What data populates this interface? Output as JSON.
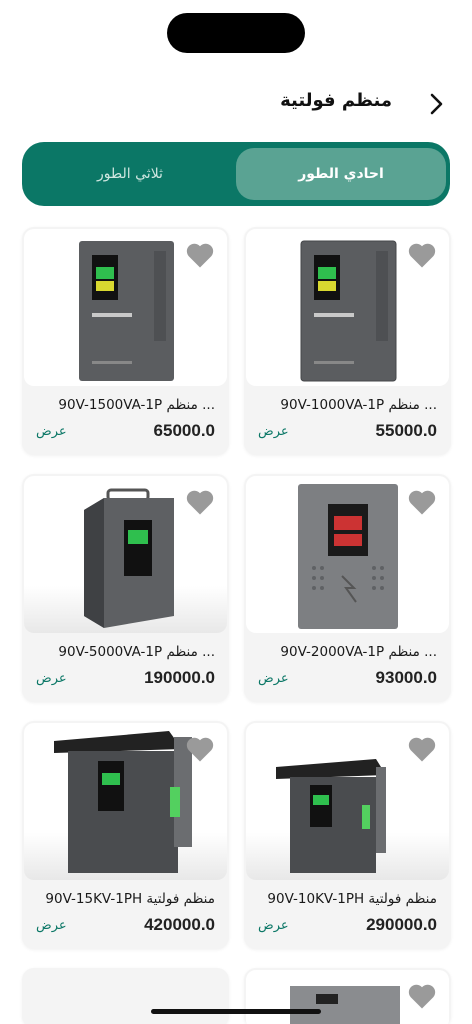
{
  "header": {
    "title": "منظم فولتية"
  },
  "tabs": [
    {
      "label": "احادي الطور",
      "active": true
    },
    {
      "label": "ثلاثي الطور",
      "active": false
    }
  ],
  "colors": {
    "accent": "#0b7766",
    "active_tab": "#5aa393",
    "heart": "#9a9a9a"
  },
  "products": [
    {
      "name": "90V-1000VA-1P منظم ...",
      "price": "55000.0",
      "action": "عرض"
    },
    {
      "name": "90V-1500VA-1P منظم ...",
      "price": "65000.0",
      "action": "عرض"
    },
    {
      "name": "90V-2000VA-1P منظم ...",
      "price": "93000.0",
      "action": "عرض"
    },
    {
      "name": "90V-5000VA-1P منظم ...",
      "price": "190000.0",
      "action": "عرض"
    },
    {
      "name": "90V-10KV-1PH منظم فولتية",
      "price": "290000.0",
      "action": "عرض"
    },
    {
      "name": "90V-15KV-1PH منظم فولتية",
      "price": "420000.0",
      "action": "عرض"
    }
  ],
  "icons": {
    "back": "chevron-right-icon",
    "favorite": "heart-icon"
  }
}
